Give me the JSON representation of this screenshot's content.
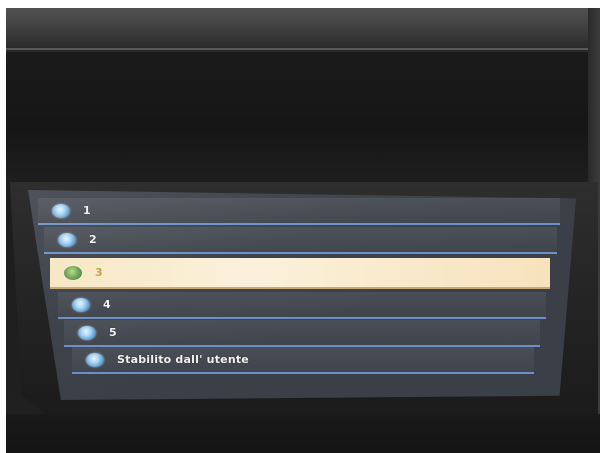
{
  "menu": {
    "items": [
      {
        "label": "1",
        "selected": false
      },
      {
        "label": "2",
        "selected": false
      },
      {
        "label": "3",
        "selected": true
      },
      {
        "label": "4",
        "selected": false
      },
      {
        "label": "5",
        "selected": false
      },
      {
        "label": "Stabilito dall' utente",
        "selected": false
      }
    ]
  },
  "colors": {
    "row_bg": "#4a4e57",
    "row_border": "#6d8fc6",
    "selected_bg": "#fbf1da",
    "selected_text": "#c59c3a",
    "text": "#f2f2f2"
  },
  "icons": {
    "bullet": "radio-bullet-icon"
  }
}
